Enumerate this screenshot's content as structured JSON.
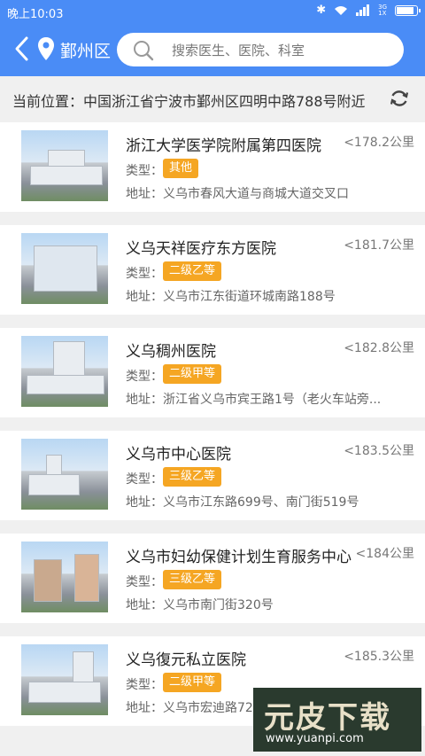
{
  "status": {
    "time": "晚上10:03",
    "net_top": "3G",
    "net_bottom": "1X"
  },
  "header": {
    "region": "鄞州区",
    "search_placeholder": "搜索医生、医院、科室"
  },
  "location": {
    "text": "当前位置：中国浙江省宁波市鄞州区四明中路788号附近"
  },
  "labels": {
    "type": "类型：",
    "address": "地址："
  },
  "hospitals": [
    {
      "name": "浙江大学医学院附属第四医院",
      "distance": "<178.2公里",
      "type": "其他",
      "address": "义乌市春风大道与商城大道交叉口"
    },
    {
      "name": "义乌天祥医疗东方医院",
      "distance": "<181.7公里",
      "type": "二级乙等",
      "address": "义乌市江东街道环城南路188号"
    },
    {
      "name": "义乌稠州医院",
      "distance": "<182.8公里",
      "type": "二级甲等",
      "address": "浙江省义乌市宾王路1号（老火车站旁..."
    },
    {
      "name": "义乌市中心医院",
      "distance": "<183.5公里",
      "type": "三级乙等",
      "address": "义乌市江东路699号、南门街519号"
    },
    {
      "name": "义乌市妇幼保健计划生育服务中心",
      "distance": "<184公里",
      "type": "三级乙等",
      "address": "义乌市南门街320号"
    },
    {
      "name": "义乌復元私立医院",
      "distance": "<185.3公里",
      "type": "二级甲等",
      "address": "义乌市宏迪路72号"
    }
  ],
  "watermark": {
    "title": "元皮下载",
    "url": "www.yuanpi.com"
  },
  "colors": {
    "primary": "#4a8cf6",
    "tag": "#f5a623"
  }
}
